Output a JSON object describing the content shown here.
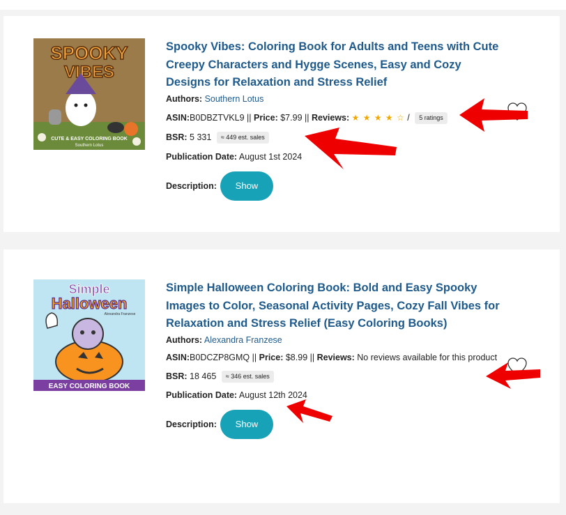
{
  "colors": {
    "link": "#1f5a8c",
    "button": "#17a2b8",
    "star": "#f0a800",
    "annotation_arrow": "#ee0000"
  },
  "books": [
    {
      "cover_title_line1": "SPOOKY",
      "cover_title_line2": "VIBES",
      "cover_subtitle": "CUTE & EASY COLORING BOOK",
      "cover_author": "Southern Lotus",
      "title": "Spooky Vibes: Coloring Book for Adults and Teens with Cute Creepy Characters and Hygge Scenes, Easy and Cozy Designs for Relaxation and Stress Relief",
      "authors_label": "Authors:",
      "author": "Southern Lotus",
      "asin_label": "ASIN:",
      "asin": "B0DBZTVKL9",
      "sep1": " || ",
      "price_label": "Price:",
      "price": "$7.99",
      "sep2": " || ",
      "reviews_label": "Reviews:",
      "rating": 4,
      "stars_text": "★ ★ ★ ★ ☆",
      "stars_sep": " / ",
      "ratings_count": "5 ratings",
      "bsr_label": "BSR:",
      "bsr": "5 331",
      "est_sales": "≈ 449 est. sales",
      "pub_label": "Publication Date:",
      "pub_date": "August 1st 2024",
      "desc_label": "Description:",
      "show_label": "Show",
      "favorite_icon": "heart-outline-icon"
    },
    {
      "cover_title_line1": "Simple",
      "cover_title_line2": "Halloween",
      "cover_author": "Alexandra Franzese",
      "cover_subtitle": "EASY COLORING BOOK",
      "title": "Simple Halloween Coloring Book: Bold and Easy Spooky Images to Color, Seasonal Activity Pages, Cozy Fall Vibes for Relaxation and Stress Relief (Easy Coloring Books)",
      "authors_label": "Authors:",
      "author": "Alexandra Franzese",
      "asin_label": "ASIN:",
      "asin": "B0DCZP8GMQ",
      "sep1": " || ",
      "price_label": "Price:",
      "price": "$8.99",
      "sep2": " || ",
      "reviews_label": "Reviews:",
      "reviews_text": "No reviews available for this product",
      "bsr_label": "BSR:",
      "bsr": "18 465",
      "est_sales": "≈ 346 est. sales",
      "pub_label": "Publication Date:",
      "pub_date": "August 12th 2024",
      "desc_label": "Description:",
      "show_label": "Show",
      "favorite_icon": "heart-outline-icon"
    }
  ]
}
